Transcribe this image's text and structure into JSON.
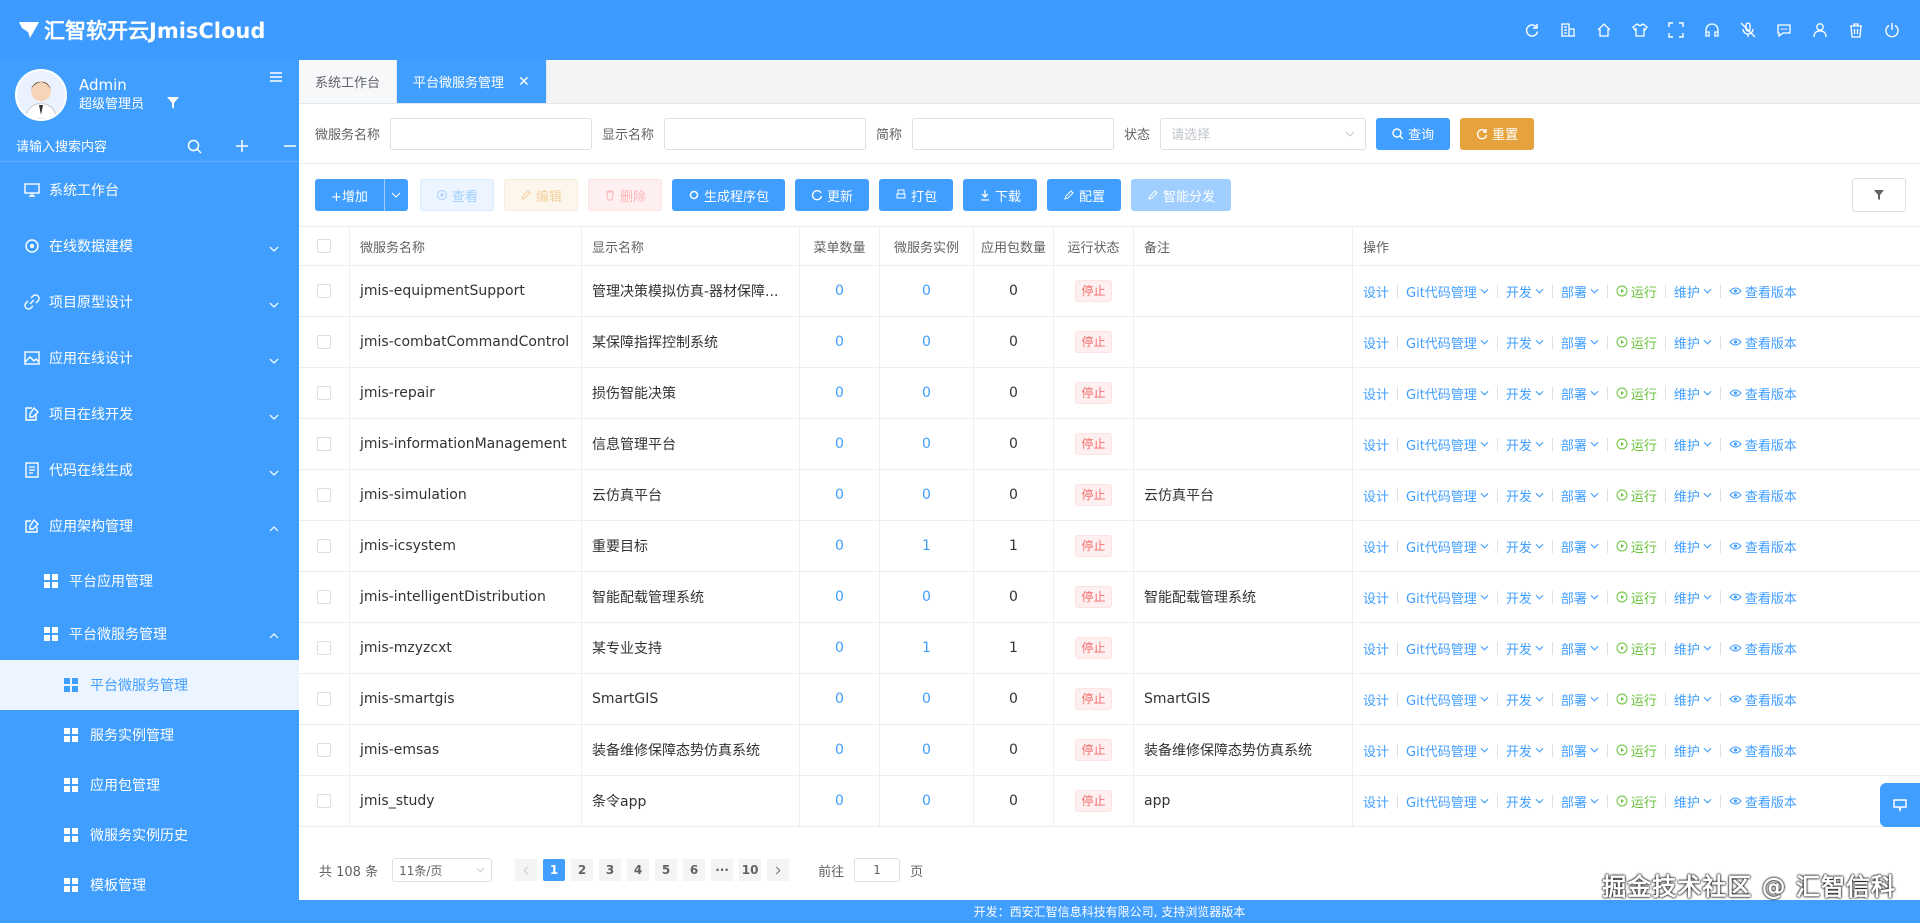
{
  "app": {
    "title": "汇智软开云JmisCloud"
  },
  "header_icons": [
    "refresh-icon",
    "building-icon",
    "home-icon",
    "shirt-icon",
    "fullscreen-icon",
    "headset-icon",
    "mic-off-icon",
    "chat-icon",
    "user-icon",
    "trash-icon",
    "power-icon"
  ],
  "user": {
    "name": "Admin",
    "role": "超级管理员"
  },
  "sidebar": {
    "search_placeholder": "请输入搜索内容",
    "items": [
      {
        "label": "系统工作台",
        "icon": "monitor-icon"
      },
      {
        "label": "在线数据建模",
        "icon": "database-icon"
      },
      {
        "label": "项目原型设计",
        "icon": "link-icon"
      },
      {
        "label": "应用在线设计",
        "icon": "image-icon"
      },
      {
        "label": "项目在线开发",
        "icon": "edit-doc-icon"
      },
      {
        "label": "代码在线生成",
        "icon": "list-doc-icon"
      },
      {
        "label": "应用架构管理",
        "icon": "edit-box-icon"
      }
    ],
    "sub_items": [
      {
        "label": "平台应用管理"
      },
      {
        "label": "平台微服务管理"
      }
    ],
    "sub2_items": [
      {
        "label": "平台微服务管理"
      },
      {
        "label": "服务实例管理"
      },
      {
        "label": "应用包管理"
      },
      {
        "label": "微服务实例历史"
      },
      {
        "label": "模板管理"
      }
    ]
  },
  "tabs": [
    {
      "label": "系统工作台"
    },
    {
      "label": "平台微服务管理"
    }
  ],
  "filters": {
    "name_label": "微服务名称",
    "display_label": "显示名称",
    "short_label": "简称",
    "state_label": "状态",
    "state_placeholder": "请选择",
    "query_btn": "查询",
    "reset_btn": "重置"
  },
  "toolbar": {
    "add": "+增加",
    "view": "查看",
    "edit": "编辑",
    "delete": "删除",
    "generate": "生成程序包",
    "update": "更新",
    "pack": "打包",
    "download": "下载",
    "config": "配置",
    "distribute": "智能分发"
  },
  "table": {
    "headers": [
      "微服务名称",
      "显示名称",
      "菜单数量",
      "微服务实例",
      "应用包数量",
      "运行状态",
      "备注",
      "操作"
    ],
    "ops": {
      "design": "设计",
      "git": "Git代码管理",
      "dev": "开发",
      "deploy": "部署",
      "run": "运行",
      "maintain": "维护",
      "version": "查看版本"
    },
    "rows": [
      {
        "name": "jmis-equipmentSupport",
        "display": "管理决策模拟仿真-器材保障...",
        "menus": "0",
        "instances": "0",
        "packages": "0",
        "state": "停止",
        "note": ""
      },
      {
        "name": "jmis-combatCommandControl",
        "display": "某保障指挥控制系统",
        "menus": "0",
        "instances": "0",
        "packages": "0",
        "state": "停止",
        "note": ""
      },
      {
        "name": "jmis-repair",
        "display": "损伤智能决策",
        "menus": "0",
        "instances": "0",
        "packages": "0",
        "state": "停止",
        "note": ""
      },
      {
        "name": "jmis-informationManagement",
        "display": "信息管理平台",
        "menus": "0",
        "instances": "0",
        "packages": "0",
        "state": "停止",
        "note": ""
      },
      {
        "name": "jmis-simulation",
        "display": "云仿真平台",
        "menus": "0",
        "instances": "0",
        "packages": "0",
        "state": "停止",
        "note": "云仿真平台"
      },
      {
        "name": "jmis-icsystem",
        "display": "重要目标",
        "menus": "0",
        "instances": "1",
        "packages": "1",
        "state": "停止",
        "note": ""
      },
      {
        "name": "jmis-intelligentDistribution",
        "display": "智能配载管理系统",
        "menus": "0",
        "instances": "0",
        "packages": "0",
        "state": "停止",
        "note": "智能配载管理系统"
      },
      {
        "name": "jmis-mzyzcxt",
        "display": "某专业支持",
        "menus": "0",
        "instances": "1",
        "packages": "1",
        "state": "停止",
        "note": ""
      },
      {
        "name": "jmis-smartgis",
        "display": "SmartGIS",
        "menus": "0",
        "instances": "0",
        "packages": "0",
        "state": "停止",
        "note": "SmartGIS"
      },
      {
        "name": "jmis-emsas",
        "display": "装备维修保障态势仿真系统",
        "menus": "0",
        "instances": "0",
        "packages": "0",
        "state": "停止",
        "note": "装备维修保障态势仿真系统"
      },
      {
        "name": "jmis_study",
        "display": "条令app",
        "menus": "0",
        "instances": "0",
        "packages": "0",
        "state": "停止",
        "note": "app"
      }
    ]
  },
  "pagination": {
    "total": "共 108 条",
    "page_size": "11条/页",
    "pages": [
      "1",
      "2",
      "3",
      "4",
      "5",
      "6",
      "···",
      "10"
    ],
    "current": "1",
    "goto_label": "前往",
    "goto_value": "1",
    "page_suffix": "页"
  },
  "footer": {
    "text": "开发：西安汇智信息科技有限公司, 支持浏览器版本"
  },
  "watermark": "掘金技术社区 @ 汇智信科",
  "colors": {
    "primary": "#409eff",
    "warning": "#e6a23c",
    "danger": "#f56c6c",
    "success": "#67c23a"
  }
}
